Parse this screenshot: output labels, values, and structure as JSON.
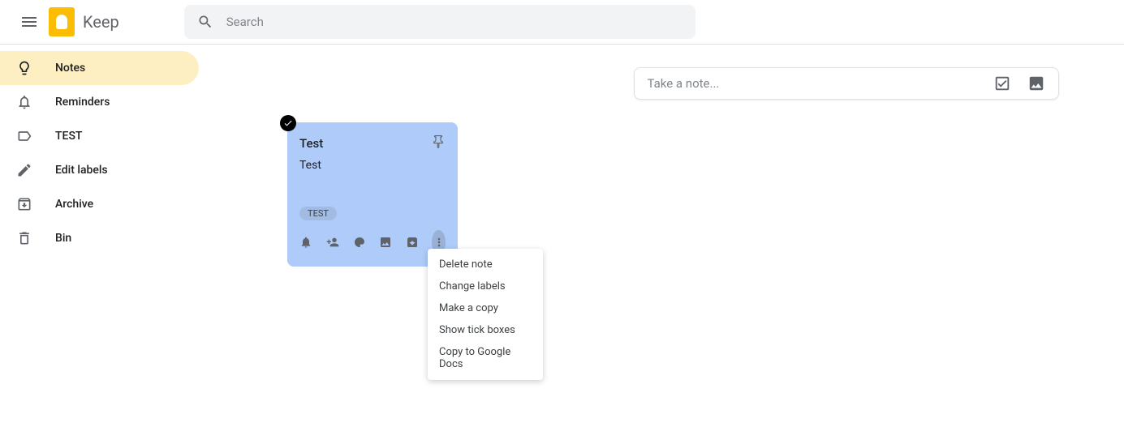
{
  "header": {
    "app_name": "Keep",
    "search_placeholder": "Search"
  },
  "sidebar": {
    "items": [
      {
        "label": "Notes"
      },
      {
        "label": "Reminders"
      },
      {
        "label": "TEST"
      },
      {
        "label": "Edit labels"
      },
      {
        "label": "Archive"
      },
      {
        "label": "Bin"
      }
    ]
  },
  "take_note": {
    "placeholder": "Take a note..."
  },
  "note": {
    "title": "Test",
    "body": "Test",
    "label": "TEST"
  },
  "menu": {
    "items": [
      "Delete note",
      "Change labels",
      "Make a copy",
      "Show tick boxes",
      "Copy to Google Docs"
    ]
  }
}
